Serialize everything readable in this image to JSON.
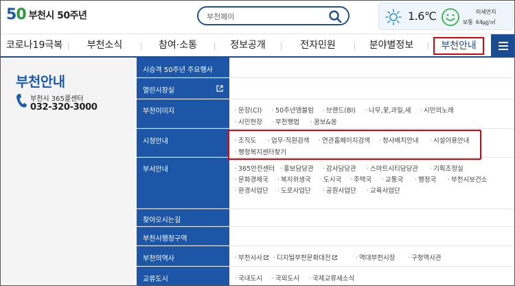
{
  "header": {
    "logo_mark": "50",
    "logo_text": "부천시 50주년",
    "search_placeholder": "부천페이",
    "weather": {
      "temperature": "1.6℃",
      "dust_title": "미세먼지",
      "dust_grade": "보통",
      "dust_value": "64㎍/㎥"
    }
  },
  "nav": {
    "items": [
      {
        "label": "코로나19극복"
      },
      {
        "label": "부천소식"
      },
      {
        "label": "참여·소통"
      },
      {
        "label": "정보공개"
      },
      {
        "label": "전자민원"
      },
      {
        "label": "분야별정보"
      },
      {
        "label": "부천안내"
      }
    ],
    "active": "부천안내"
  },
  "left": {
    "title": "부천안내",
    "callcenter_label": "부천시 365콜센터",
    "callcenter_number": "032-320-3000"
  },
  "sitemap": {
    "rows": [
      {
        "category": "시승격 50주년 주요행사",
        "links": []
      },
      {
        "category": "열린시장실",
        "links": []
      },
      {
        "category": "부천이미지",
        "links": [
          "문장(CI)",
          "50주년엠블럼",
          "브랜드(BI)",
          "나무,꽃,과일,새",
          "시민의노래",
          "시민헌장",
          "부천행법",
          "꿈보&쏭"
        ]
      },
      {
        "category": "시청안내",
        "links": [
          "조직도",
          "업무·직원검색",
          "연관홈페이지검색",
          "청사배치안내",
          "시설이용안내",
          "행정복지센터찾기"
        ]
      },
      {
        "category": "부서안내",
        "links": [
          "365안전센터",
          "홍보담당관",
          "감사담당관",
          "스마트시티담당관",
          "기획조정실",
          "문화경제국",
          "복지위생국",
          "도시국",
          "주택국",
          "교통국",
          "행정국",
          "부천시보건소",
          "환경사업단",
          "도로사업단",
          "공원사업단",
          "교육사업단"
        ]
      },
      {
        "category": "찾아오시는길",
        "links": []
      },
      {
        "category": "부천시행정구역",
        "links": []
      },
      {
        "category": "부천의역사",
        "links": [
          "부천시사",
          "디지털부천문화대전",
          "역대부천시장",
          "구청역사관"
        ]
      },
      {
        "category": "교류도시",
        "links": [
          "국내도시",
          "국외도시",
          "국제교류새소식"
        ]
      }
    ]
  },
  "colors": {
    "brand_blue": "#1d56a7",
    "highlight_red": "#e0000b"
  }
}
